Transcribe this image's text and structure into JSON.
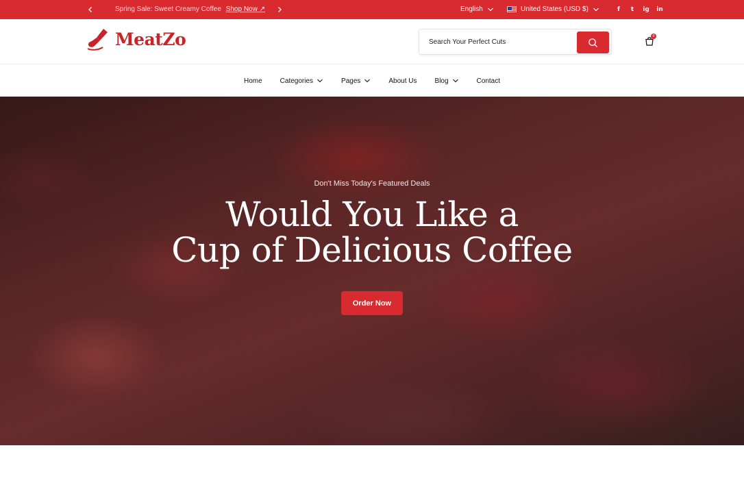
{
  "topbar": {
    "promo_text": "Spring Sale: Sweet Creamy Coffee",
    "promo_link": "Shop Now ↗",
    "language": "English",
    "currency": "United States (USD $)",
    "socials": [
      "f",
      "t",
      "ig",
      "in"
    ],
    "bg_color": "#d92a30"
  },
  "header": {
    "logo_text": "MeatZo",
    "search_placeholder": "Search Your Perfect Cuts",
    "cart_count": "0",
    "accent_color": "#d92a30"
  },
  "nav": {
    "items": [
      {
        "label": "Home",
        "dropdown": false
      },
      {
        "label": "Categories",
        "dropdown": true
      },
      {
        "label": "Pages",
        "dropdown": true
      },
      {
        "label": "About Us",
        "dropdown": false
      },
      {
        "label": "Blog",
        "dropdown": true
      },
      {
        "label": "Contact",
        "dropdown": false
      }
    ]
  },
  "hero": {
    "subtitle": "Don't Miss Today's Featured Deals",
    "title_line1": "Would You Like a",
    "title_line2": "Cup of Delicious Coffee",
    "button_label": "Order Now"
  }
}
